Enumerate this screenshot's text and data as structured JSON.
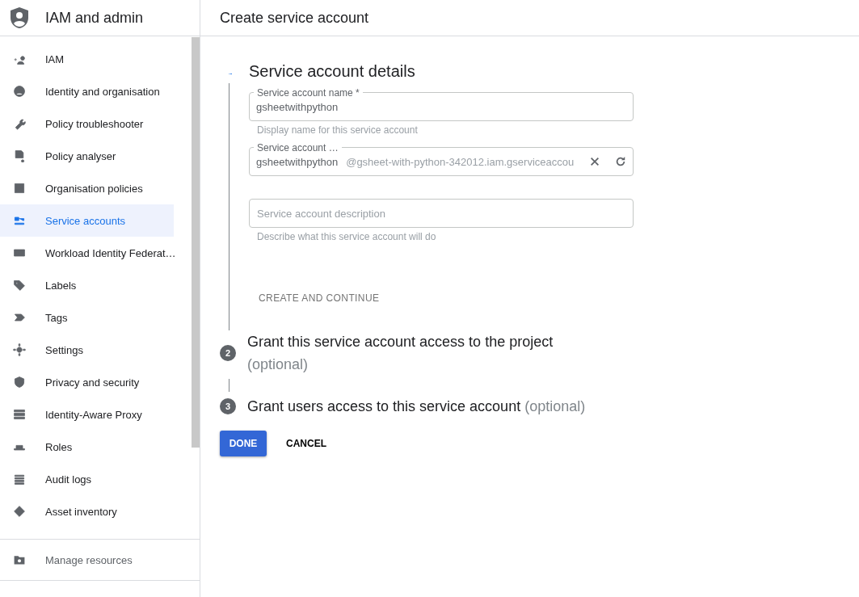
{
  "sidebar": {
    "title": "IAM and admin",
    "items": [
      {
        "label": "IAM",
        "selected": false
      },
      {
        "label": "Identity and organisation",
        "selected": false
      },
      {
        "label": "Policy troubleshooter",
        "selected": false
      },
      {
        "label": "Policy analyser",
        "selected": false
      },
      {
        "label": "Organisation policies",
        "selected": false
      },
      {
        "label": "Service accounts",
        "selected": true
      },
      {
        "label": "Workload Identity Federat…",
        "selected": false
      },
      {
        "label": "Labels",
        "selected": false
      },
      {
        "label": "Tags",
        "selected": false
      },
      {
        "label": "Settings",
        "selected": false
      },
      {
        "label": "Privacy and security",
        "selected": false
      },
      {
        "label": "Identity-Aware Proxy",
        "selected": false
      },
      {
        "label": "Roles",
        "selected": false
      },
      {
        "label": "Audit logs",
        "selected": false
      },
      {
        "label": "Asset inventory",
        "selected": false
      }
    ],
    "footer_item": {
      "label": "Manage resources"
    }
  },
  "page": {
    "title": "Create service account"
  },
  "step_1": {
    "title": "Service account details",
    "name_field": {
      "label": "Service account name *",
      "value": "gsheetwithpython",
      "hint": "Display name for this service account"
    },
    "id_field": {
      "label": "Service account …",
      "value": "gsheetwithpython",
      "suffix": "@gsheet-with-python-342012.iam.gserviceaccou"
    },
    "description_field": {
      "placeholder": "Service account description",
      "hint": "Describe what this service account will do"
    },
    "continue_button": "CREATE AND CONTINUE"
  },
  "later_steps": [
    {
      "number": "2",
      "title": "Grant this service account access to the project",
      "optional": "(optional)"
    },
    {
      "number": "3",
      "title": "Grant users access to this service account",
      "optional": "(optional)"
    }
  ],
  "buttons": {
    "done": "DONE",
    "cancel": "CANCEL"
  }
}
